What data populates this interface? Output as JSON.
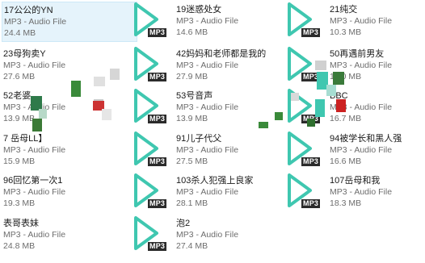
{
  "items": [
    {
      "name": "17公公的YN",
      "type": "MP3 - Audio File",
      "size": "24.4 MB",
      "selected": true
    },
    {
      "name": "19迷惑处女",
      "type": "MP3 - Audio File",
      "size": "14.6 MB"
    },
    {
      "name": "21纯交",
      "type": "MP3 - Audio File",
      "size": "10.3 MB"
    },
    {
      "name": "23母狗卖Y",
      "type": "MP3 - Audio File",
      "size": "27.6 MB"
    },
    {
      "name": "42妈妈和老师都是我的",
      "type": "MP3 - Audio File",
      "size": "27.9 MB"
    },
    {
      "name": "50再遇前男友",
      "type": "MP3 - Audio File",
      "size": "16.0 MB"
    },
    {
      "name": "52老婆",
      "type": "MP3 - Audio File",
      "size": "13.9 MB"
    },
    {
      "name": "53号音声",
      "type": "MP3 - Audio File",
      "size": "13.9 MB"
    },
    {
      "name": "BBC",
      "type": "MP3 - Audio File",
      "size": "16.7 MB"
    },
    {
      "name": "7 岳母LL】",
      "type": "MP3 - Audio File",
      "size": "15.9 MB"
    },
    {
      "name": "91儿子代父",
      "type": "MP3 - Audio File",
      "size": "27.5 MB"
    },
    {
      "name": "94被学长和黑人强",
      "type": "MP3 - Audio File",
      "size": "16.6 MB"
    },
    {
      "name": "96回忆第一次1",
      "type": "MP3 - Audio File",
      "size": "19.3 MB"
    },
    {
      "name": "103杀人犯强上良家",
      "type": "MP3 - Audio File",
      "size": "28.1 MB"
    },
    {
      "name": "107岳母和我",
      "type": "MP3 - Audio File",
      "size": "18.3 MB"
    },
    {
      "name": "表哥表妹",
      "type": "MP3 - Audio File",
      "size": "24.8 MB"
    },
    {
      "name": "泡2",
      "type": "MP3 - Audio File",
      "size": "27.4 MB"
    }
  ],
  "icon": {
    "name": "mp3-play-icon",
    "badge": "MP3",
    "accent": "#3fc7b0",
    "badge_bg": "#2b2b2b"
  }
}
